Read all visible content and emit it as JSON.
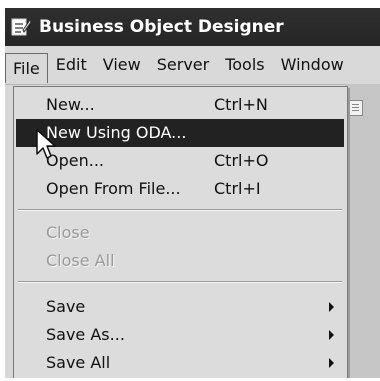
{
  "window": {
    "title": "Business Object Designer",
    "icon": "designer-app-icon"
  },
  "menubar": {
    "items": [
      "File",
      "Edit",
      "View",
      "Server",
      "Tools",
      "Window"
    ],
    "active": "File"
  },
  "file_menu": {
    "items": [
      {
        "label": "New...",
        "shortcut": "Ctrl+N",
        "enabled": true
      },
      {
        "label": "New Using ODA...",
        "shortcut": "",
        "enabled": true,
        "highlighted": true
      },
      {
        "label": "Open...",
        "shortcut": "Ctrl+O",
        "enabled": true
      },
      {
        "label": "Open From File...",
        "shortcut": "Ctrl+I",
        "enabled": true
      },
      {
        "label": "Close",
        "shortcut": "",
        "enabled": false
      },
      {
        "label": "Close All",
        "shortcut": "",
        "enabled": false
      },
      {
        "label": "Save",
        "shortcut": "",
        "enabled": true,
        "submenu": true
      },
      {
        "label": "Save As...",
        "shortcut": "",
        "enabled": true,
        "submenu": true
      },
      {
        "label": "Save All",
        "shortcut": "",
        "enabled": true,
        "submenu": true
      }
    ]
  },
  "colors": {
    "title_bar": "#2a2a2a",
    "menu_bg": "#dcdcdc",
    "highlight": "#222222",
    "disabled_text": "#9a9a9a"
  },
  "icons": [
    "designer-app-icon",
    "document-icon",
    "mouse-pointer-icon",
    "submenu-arrow-icon"
  ]
}
